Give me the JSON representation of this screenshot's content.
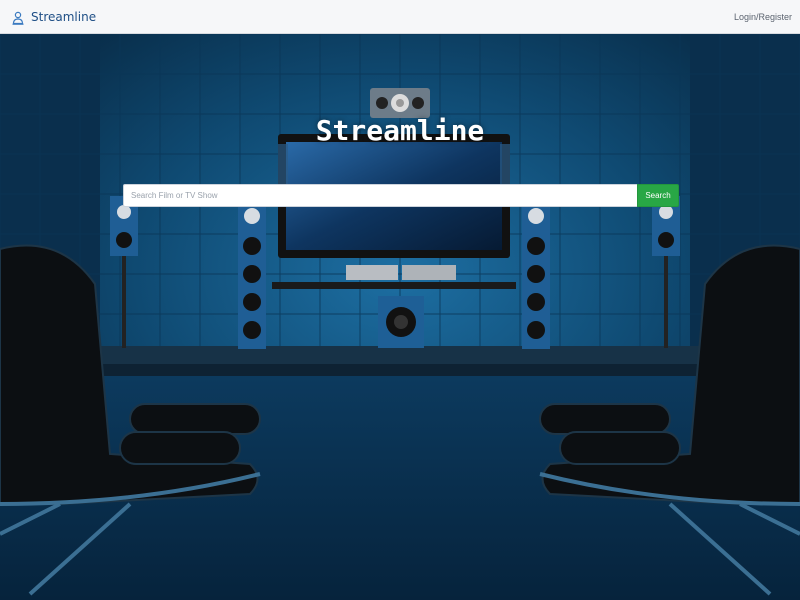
{
  "navbar": {
    "brand_name": "Streamline",
    "brand_icon": "person-icon",
    "login_label": "Login/Register"
  },
  "hero": {
    "title": "Streamline",
    "search": {
      "placeholder": "Search Film or TV Show",
      "value": "",
      "button_label": "Search"
    },
    "background_image": "home-theater-room"
  },
  "colors": {
    "navbar_bg": "#f6f7f9",
    "brand": "#1f4f86",
    "search_button": "#28a745",
    "room_blue": "#0f4a72"
  }
}
